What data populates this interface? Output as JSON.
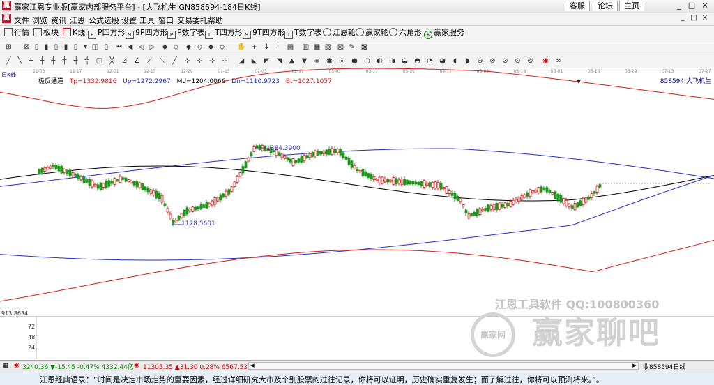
{
  "window": {
    "title": "赢家江恩专业版[赢家内部服务平台] - [大飞机生  GN858594-184日K线]",
    "top_buttons": [
      "客服",
      "论坛",
      "主页"
    ],
    "window_buttons": [
      "_",
      "□",
      "×"
    ]
  },
  "menu": {
    "items": [
      "文件",
      "浏览",
      "资讯",
      "江恩",
      "公式选股",
      "设置",
      "工具",
      "窗口",
      "交易委托",
      "帮助"
    ],
    "right_buttons": [
      "_",
      "□",
      "×"
    ]
  },
  "toolbar1": {
    "items": [
      "行情",
      "板块",
      "K线",
      "P四方形",
      "9P四方形",
      "P数字表",
      "T四方形",
      "9T四方形",
      "T数字表",
      "江恩轮",
      "赢家轮",
      "六角形",
      "赢家服务"
    ]
  },
  "chart": {
    "period_label": "日K线",
    "indicator_name": "极反通道",
    "tp": "Tp=1332.9816",
    "up": "Up=1272.2967",
    "md": "Md=1204.0066",
    "dn": "Dn=1110.9723",
    "bt": "Bt=1027.1057",
    "stock_code": "858594  大飞机生",
    "high_label": "1384.3900",
    "low_label": "1128.5601",
    "x_labels": [
      "11-03",
      "11-17",
      "12-01",
      "12-15",
      "12-29",
      "01-13",
      "02-03",
      "02-17",
      "03-03",
      "03-17",
      "03-31",
      "04-17",
      "05-04",
      "05-18",
      "06-01",
      "06-15",
      "06-29",
      "07-13",
      "07-27"
    ],
    "y_main": "913.8634",
    "y_ticks": [
      "72",
      "48",
      "24"
    ],
    "colors": {
      "red": "#d41a1a",
      "blue": "#2230c8",
      "black": "#000000",
      "up": "#d41a1a",
      "down": "#1a9a1a"
    }
  },
  "watermark": {
    "line1": "江恩工具软件  QQ:100800360",
    "circle_text": "赢家网",
    "big": "赢家聊吧",
    "url": "jiaoba.yj360"
  },
  "status": {
    "shanghai": "3240.36 ▼-15.45 -0.47% 4332.44亿",
    "shenzhen": "11305.35 ▲31.30 0.28% 6567.53亿",
    "right_label": "收858594日线"
  },
  "quote": "江恩经典语录：“时间是决定市场走势的重要因素，经过详细研究大市及个别股票的过往记录，你将可以证明，历史确实重复发生；而了解过往，你将可以预测将来。”。"
}
